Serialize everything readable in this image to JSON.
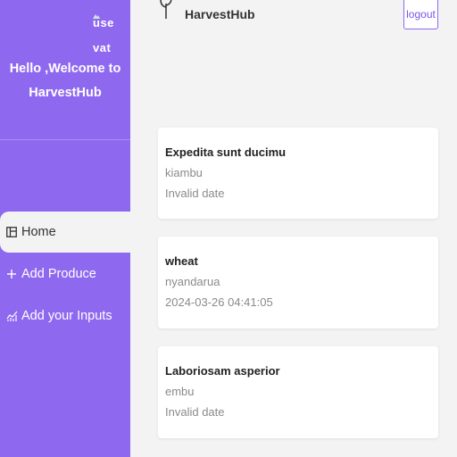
{
  "sidebar": {
    "avatar_alt": "user avatar",
    "avatar_alt_visible": "use\nvat",
    "greeting_line1": "Hello ,Welcome to",
    "greeting_line2": "HarvestHub",
    "items": [
      {
        "label": "Home",
        "icon": "layout-icon",
        "active": true
      },
      {
        "label": "Add Produce",
        "icon": "plus-icon",
        "active": false
      },
      {
        "label": "Add your Inputs",
        "icon": "chart-icon",
        "active": false
      }
    ]
  },
  "header": {
    "brand": "HarvestHub",
    "logout_label": "logout"
  },
  "produce": [
    {
      "title": "Expedita sunt ducimu",
      "location": "kiambu",
      "date": "Invalid date"
    },
    {
      "title": "wheat",
      "location": "nyandarua",
      "date": "2024-03-26 04:41:05"
    },
    {
      "title": "Laboriosam asperior",
      "location": "embu",
      "date": "Invalid date"
    }
  ],
  "colors": {
    "accent": "#8f68f0",
    "background": "#f3f3f3"
  }
}
